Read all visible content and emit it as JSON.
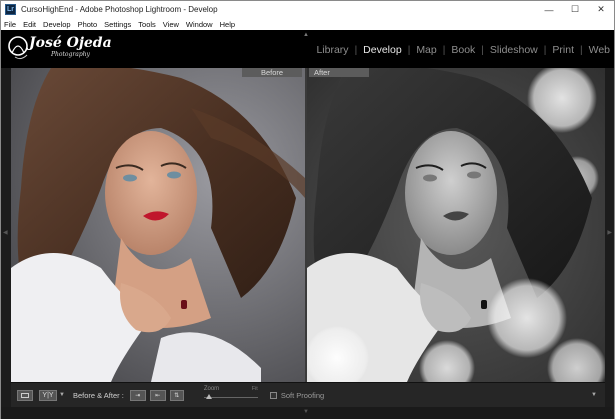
{
  "window": {
    "title": "CursoHighEnd - Adobe Photoshop Lightroom - Develop",
    "app_icon_text": "Lr",
    "controls": {
      "minimize": "—",
      "maximize": "☐",
      "close": "✕"
    }
  },
  "menu": [
    "File",
    "Edit",
    "Develop",
    "Photo",
    "Settings",
    "Tools",
    "View",
    "Window",
    "Help"
  ],
  "identity_plate": {
    "name": "José Ojeda",
    "sub": "Photography"
  },
  "modules": [
    {
      "label": "Library",
      "active": false
    },
    {
      "label": "Develop",
      "active": true
    },
    {
      "label": "Map",
      "active": false
    },
    {
      "label": "Book",
      "active": false
    },
    {
      "label": "Slideshow",
      "active": false
    },
    {
      "label": "Print",
      "active": false
    },
    {
      "label": "Web",
      "active": false
    }
  ],
  "views": {
    "before_label": "Before",
    "after_label": "After"
  },
  "toolbar": {
    "view_mode_icon": "loupe-view-icon",
    "yy_label": "Y|Y",
    "before_after_label": "Before & After :",
    "zoom_label": "Zoom",
    "zoom_fit_label": "Fit",
    "soft_proofing_label": "Soft Proofing",
    "soft_proofing_checked": false
  },
  "colors": {
    "panel_bg": "#1c1c1c",
    "active_module": "#e8e8e8",
    "inactive_module": "#8e8e8e",
    "lip_red": "#c0162c"
  }
}
